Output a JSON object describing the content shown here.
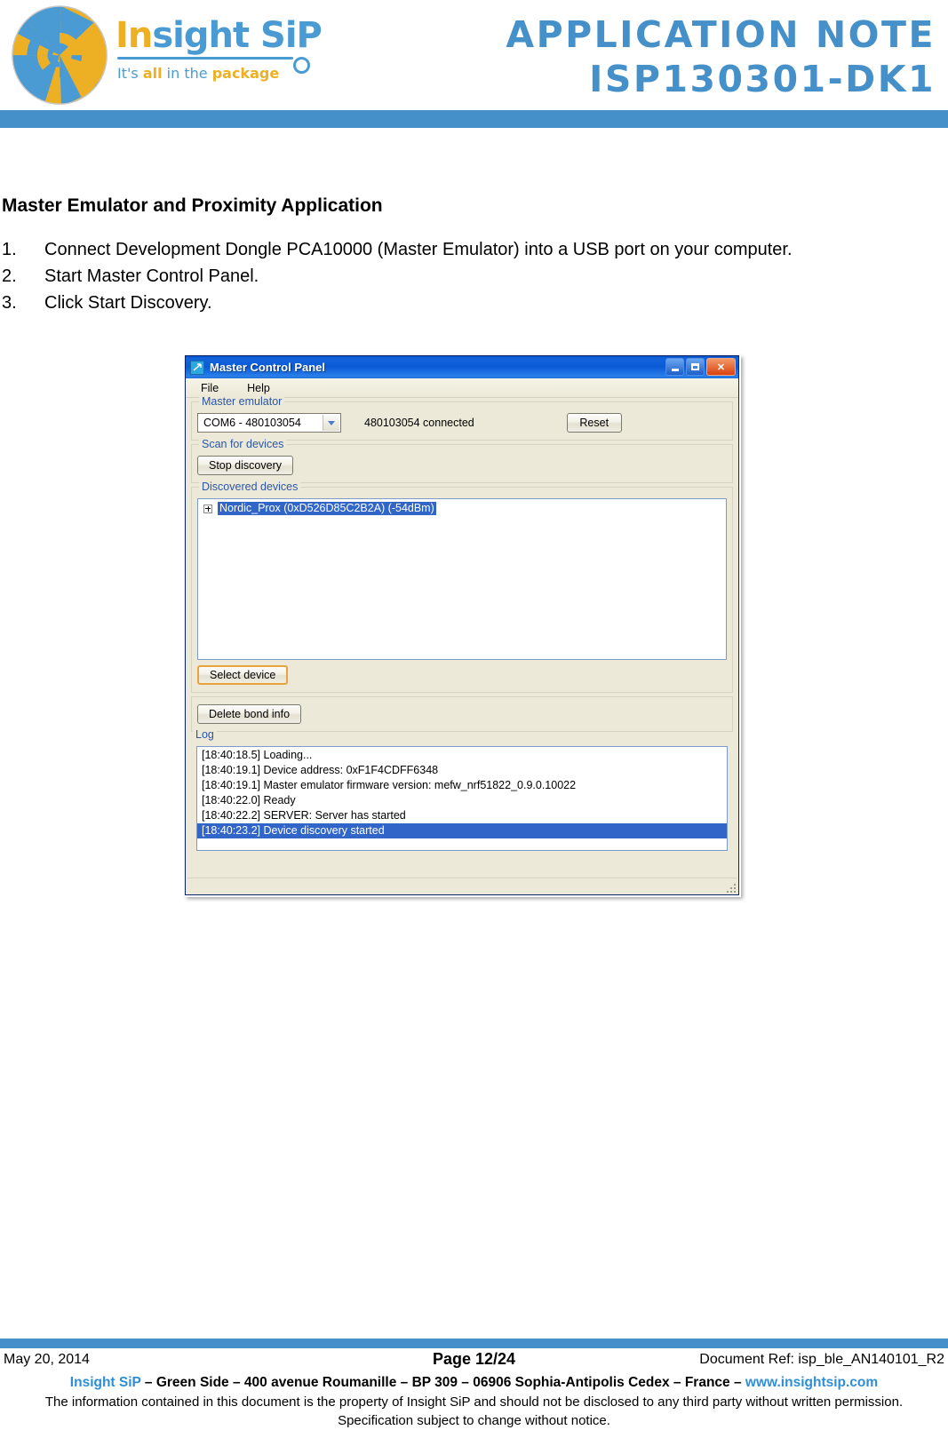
{
  "header": {
    "logo": {
      "brand_part1": "In",
      "brand_part2": "sight SiP",
      "tagline_a": "It's ",
      "tagline_b": "all",
      "tagline_c": " in the ",
      "tagline_d": "package"
    },
    "title_line1": "APPLICATION NOTE",
    "title_line2": "ISP130301-DK1",
    "accent_color": "#4590C9"
  },
  "body": {
    "section_heading": "Master Emulator and Proximity Application",
    "steps": [
      {
        "num": "1.",
        "text": "Connect Development Dongle PCA10000 (Master Emulator) into a USB port on your computer."
      },
      {
        "num": "2.",
        "text": "Start Master Control Panel."
      },
      {
        "num": "3.",
        "text": "Click Start Discovery."
      }
    ]
  },
  "screenshot": {
    "window": {
      "title": "Master Control Panel",
      "icon": "app-icon",
      "buttons": {
        "minimize": "Minimize",
        "maximize": "Maximize",
        "close": "✕"
      }
    },
    "menu": [
      {
        "label": "File"
      },
      {
        "label": "Help"
      }
    ],
    "master_emulator": {
      "group_label": "Master emulator",
      "combo_value": "COM6 - 480103054",
      "status": "480103054 connected",
      "reset_label": "Reset"
    },
    "scan_for_devices": {
      "group_label": "Scan for devices",
      "button_label": "Stop discovery"
    },
    "discovered_devices": {
      "group_label": "Discovered devices",
      "items": [
        {
          "label": "Nordic_Prox (0xD526D85C2B2A) (-54dBm)",
          "selected": true
        }
      ],
      "select_button_label": "Select device"
    },
    "bond": {
      "delete_button_label": "Delete bond info"
    },
    "log": {
      "group_label": "Log",
      "lines": [
        {
          "text": "[18:40:18.5] Loading...",
          "selected": false
        },
        {
          "text": "[18:40:19.1] Device address: 0xF1F4CDFF6348",
          "selected": false
        },
        {
          "text": "[18:40:19.1] Master emulator firmware version: mefw_nrf51822_0.9.0.10022",
          "selected": false
        },
        {
          "text": "[18:40:22.0] Ready",
          "selected": false
        },
        {
          "text": "[18:40:22.2] SERVER: Server has started",
          "selected": false
        },
        {
          "text": "[18:40:23.2] Device discovery started",
          "selected": true
        }
      ]
    }
  },
  "footer": {
    "date": "May 20, 2014",
    "page": "Page 12/24",
    "doc_ref": "Document Ref: isp_ble_AN140101_R2",
    "address_company": "Insight SiP",
    "address_mid": " – Green Side – 400 avenue Roumanille – BP 309 – 06906 Sophia-Antipolis Cedex – France – ",
    "address_url": "www.insightsip.com",
    "note_line1": "The information contained in this document is the property of Insight SiP and should not be disclosed to any third party without written permission.",
    "note_line2": "Specification subject to change without notice."
  }
}
